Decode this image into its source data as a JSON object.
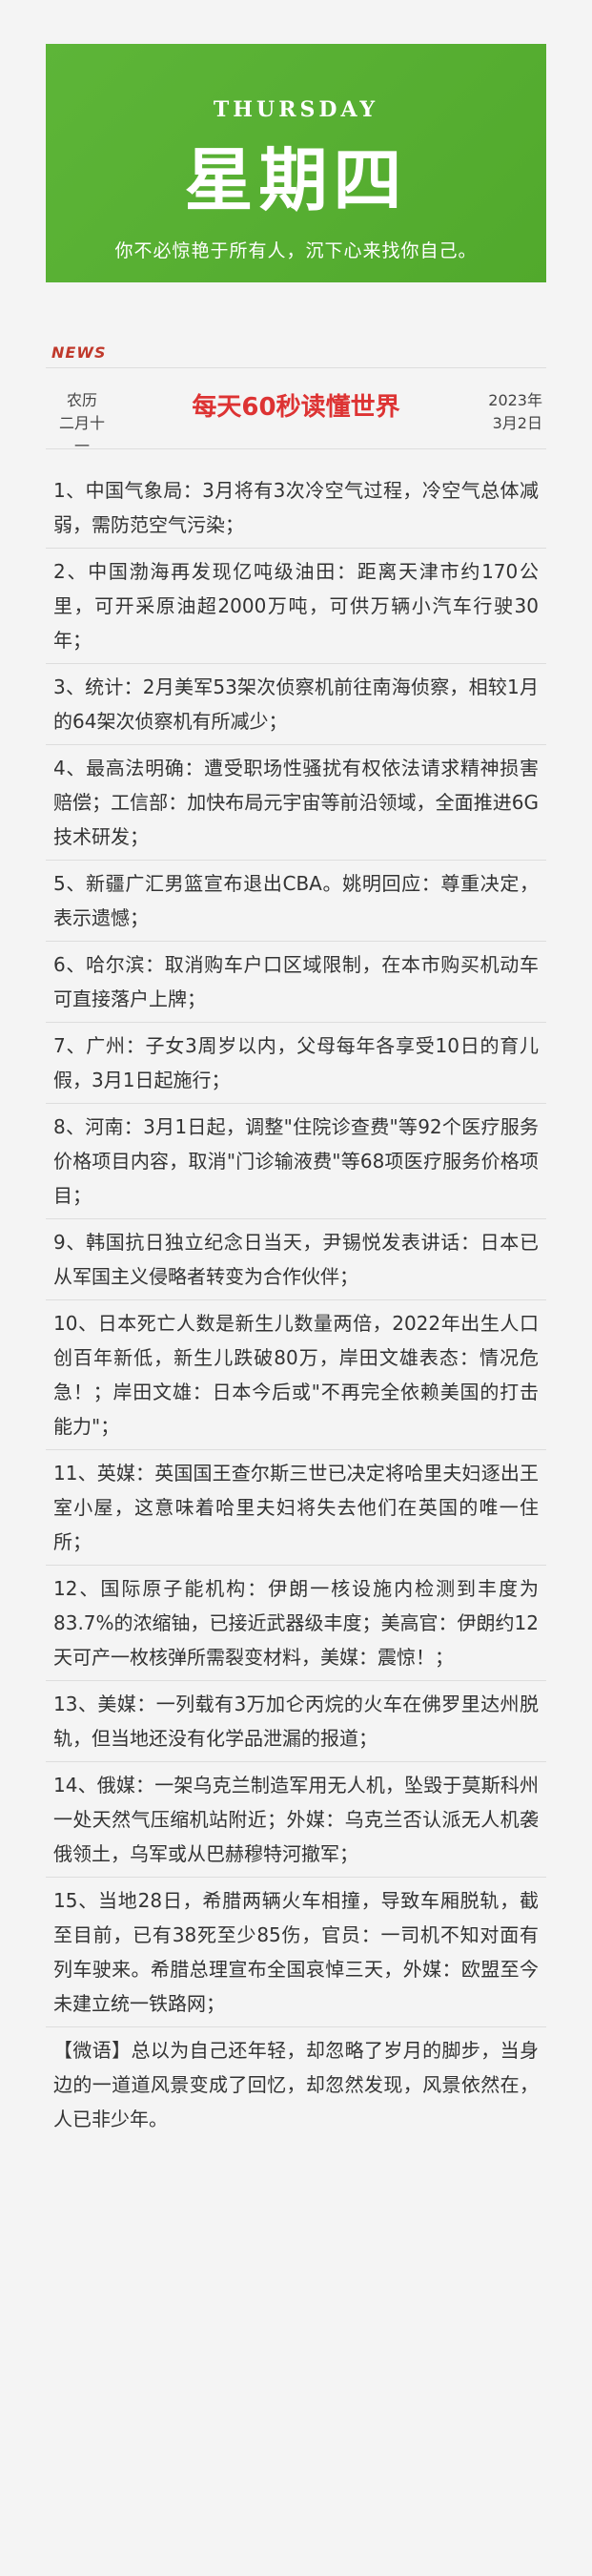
{
  "banner": {
    "weekday_en": "THURSDAY",
    "weekday_cn": "星期四",
    "motto": "你不必惊艳于所有人，沉下心来找你自己。"
  },
  "header": {
    "tag": "NEWS",
    "lunar_label": "农历",
    "lunar_date": "二月十一",
    "title": "每天60秒读懂世界",
    "year": "2023年",
    "date": "3月2日"
  },
  "items": [
    "1、中国气象局：3月将有3次冷空气过程，冷空气总体减弱，需防范空气污染；",
    "2、中国渤海再发现亿吨级油田：距离天津市约170公里，可开采原油超2000万吨，可供万辆小汽车行驶30年；",
    "3、统计：2月美军53架次侦察机前往南海侦察，相较1月的64架次侦察机有所减少；",
    "4、最高法明确：遭受职场性骚扰有权依法请求精神损害赔偿；工信部：加快布局元宇宙等前沿领域，全面推进6G技术研发；",
    "5、新疆广汇男篮宣布退出CBA。姚明回应：尊重决定，表示遗憾；",
    "6、哈尔滨：取消购车户口区域限制，在本市购买机动车可直接落户上牌；",
    "7、广州：子女3周岁以内，父母每年各享受10日的育儿假，3月1日起施行；",
    "8、河南：3月1日起，调整\"住院诊查费\"等92个医疗服务价格项目内容，取消\"门诊输液费\"等68项医疗服务价格项目；",
    "9、韩国抗日独立纪念日当天，尹锡悦发表讲话：日本已从军国主义侵略者转变为合作伙伴；",
    "10、日本死亡人数是新生儿数量两倍，2022年出生人口创百年新低，新生儿跌破80万，岸田文雄表态：情况危急！；岸田文雄：日本今后或\"不再完全依赖美国的打击能力\"；",
    "11、英媒：英国国王查尔斯三世已决定将哈里夫妇逐出王室小屋，这意味着哈里夫妇将失去他们在英国的唯一住所；",
    "12、国际原子能机构：伊朗一核设施内检测到丰度为83.7%的浓缩铀，已接近武器级丰度；美高官：伊朗约12天可产一枚核弹所需裂变材料，美媒：震惊！；",
    "13、美媒：一列载有3万加仑丙烷的火车在佛罗里达州脱轨，但当地还没有化学品泄漏的报道；",
    "14、俄媒：一架乌克兰制造军用无人机，坠毁于莫斯科州一处天然气压缩机站附近；外媒：乌克兰否认派无人机袭俄领土，乌军或从巴赫穆特河撤军；",
    "15、当地28日，希腊两辆火车相撞，导致车厢脱轨，截至目前，已有38死至少85伤，官员：一司机不知对面有列车驶来。希腊总理宣布全国哀悼三天，外媒：欧盟至今未建立统一铁路网；",
    "【微语】总以为自己还年轻，却忽略了岁月的脚步，当身边的一道道风景变成了回忆，却忽然发现，风景依然在，人已非少年。"
  ]
}
